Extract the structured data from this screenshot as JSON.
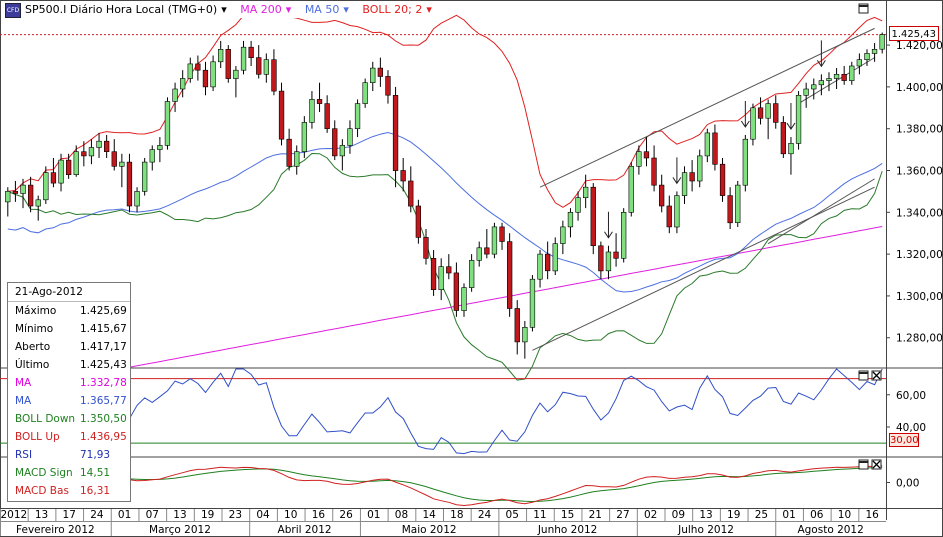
{
  "header": {
    "symbol": "SP500.I Diário Hora Local (TMG+0)",
    "ma200": "MA 200",
    "ma50": "MA 50",
    "boll": "BOLL 20; 2",
    "logo_text": "CFD"
  },
  "legend": {
    "date": "21-Ago-2012",
    "rows": [
      {
        "label": "Máximo",
        "value": "1.425,69",
        "color": "#000000"
      },
      {
        "label": "Mínimo",
        "value": "1.415,67",
        "color": "#000000"
      },
      {
        "label": "Aberto",
        "value": "1.417,17",
        "color": "#000000"
      },
      {
        "label": "Último",
        "value": "1.425,43",
        "color": "#000000"
      },
      {
        "label": "MA",
        "value": "1.332,78",
        "color": "#e000e0"
      },
      {
        "label": "MA",
        "value": "1.365,77",
        "color": "#3050d0"
      },
      {
        "label": "BOLL Down",
        "value": "1.350,50",
        "color": "#208020"
      },
      {
        "label": "BOLL Up",
        "value": "1.436,95",
        "color": "#d02020"
      },
      {
        "label": "RSI",
        "value": "71,93",
        "color": "#2030b0"
      },
      {
        "label": "MACD Sign",
        "value": "14,51",
        "color": "#208020"
      },
      {
        "label": "MACD Bas",
        "value": "16,31",
        "color": "#d02020"
      }
    ]
  },
  "price_labels": {
    "last": "1.425,43",
    "rsi_level": "30,00"
  },
  "chart_data": {
    "type": "candlestick",
    "y_axis_ticks": [
      "1.420,00",
      "1.400,00",
      "1.380,00",
      "1.360,00",
      "1.340,00",
      "1.320,00",
      "1.300,00",
      "1.280,00"
    ],
    "ylim": [
      1266,
      1432
    ],
    "rsi_ticks": [
      "60,00",
      "40,00"
    ],
    "rsi_ylim": [
      22,
      76
    ],
    "rsi_level": 30,
    "macd_ticks": [
      "0,00"
    ],
    "macd_ylim": [
      -24,
      24
    ],
    "x_day_labels": [
      "2012",
      "13",
      "17",
      "24",
      "01",
      "07",
      "13",
      "19",
      "23",
      "04",
      "10",
      "16",
      "26",
      "01",
      "08",
      "14",
      "18",
      "24",
      "05",
      "11",
      "15",
      "21",
      "27",
      "02",
      "09",
      "13",
      "19",
      "25",
      "01",
      "06",
      "10",
      "16"
    ],
    "x_month_labels": [
      "Fevereiro 2012",
      "Março 2012",
      "Abril 2012",
      "Maio 2012",
      "Junho 2012",
      "Julho 2012",
      "Agosto 2012"
    ],
    "colors": {
      "up": "#80e080",
      "down": "#c0181c",
      "ma200": "#e020e0",
      "ma50": "#4d6fe0",
      "boll_up": "#e02020",
      "boll_mid": "#e02020",
      "boll_down": "#2a7a2a",
      "rsi": "#3050c8",
      "macd_sign": "#208020",
      "macd_bas": "#d02020"
    },
    "ohlc": [
      [
        1345,
        1352,
        1338,
        1350
      ],
      [
        1350,
        1355,
        1345,
        1349
      ],
      [
        1349,
        1356,
        1342,
        1353
      ],
      [
        1353,
        1357,
        1340,
        1343
      ],
      [
        1343,
        1348,
        1336,
        1346
      ],
      [
        1346,
        1362,
        1344,
        1359
      ],
      [
        1359,
        1366,
        1352,
        1354
      ],
      [
        1354,
        1368,
        1350,
        1365
      ],
      [
        1365,
        1368,
        1356,
        1358
      ],
      [
        1358,
        1372,
        1357,
        1369
      ],
      [
        1369,
        1374,
        1362,
        1367
      ],
      [
        1367,
        1375,
        1363,
        1371
      ],
      [
        1371,
        1378,
        1366,
        1374
      ],
      [
        1374,
        1377,
        1366,
        1369
      ],
      [
        1369,
        1375,
        1360,
        1362
      ],
      [
        1362,
        1368,
        1352,
        1364
      ],
      [
        1364,
        1368,
        1340,
        1343
      ],
      [
        1343,
        1352,
        1340,
        1350
      ],
      [
        1350,
        1366,
        1348,
        1364
      ],
      [
        1364,
        1372,
        1360,
        1370
      ],
      [
        1370,
        1376,
        1364,
        1372
      ],
      [
        1372,
        1395,
        1370,
        1393
      ],
      [
        1393,
        1402,
        1388,
        1399
      ],
      [
        1399,
        1408,
        1395,
        1404
      ],
      [
        1404,
        1414,
        1402,
        1411
      ],
      [
        1411,
        1415,
        1403,
        1408
      ],
      [
        1408,
        1412,
        1396,
        1400
      ],
      [
        1400,
        1415,
        1398,
        1412
      ],
      [
        1412,
        1422,
        1409,
        1418
      ],
      [
        1418,
        1420,
        1402,
        1404
      ],
      [
        1404,
        1410,
        1395,
        1408
      ],
      [
        1408,
        1422,
        1406,
        1419
      ],
      [
        1419,
        1422,
        1410,
        1414
      ],
      [
        1414,
        1420,
        1404,
        1406
      ],
      [
        1406,
        1416,
        1402,
        1413
      ],
      [
        1413,
        1418,
        1396,
        1398
      ],
      [
        1398,
        1402,
        1372,
        1375
      ],
      [
        1375,
        1380,
        1360,
        1362
      ],
      [
        1362,
        1372,
        1358,
        1369
      ],
      [
        1369,
        1386,
        1366,
        1383
      ],
      [
        1383,
        1398,
        1380,
        1394
      ],
      [
        1394,
        1402,
        1388,
        1392
      ],
      [
        1392,
        1396,
        1378,
        1380
      ],
      [
        1380,
        1384,
        1365,
        1367
      ],
      [
        1367,
        1375,
        1360,
        1372
      ],
      [
        1372,
        1384,
        1368,
        1380
      ],
      [
        1380,
        1394,
        1376,
        1392
      ],
      [
        1392,
        1404,
        1390,
        1402
      ],
      [
        1402,
        1412,
        1398,
        1409
      ],
      [
        1409,
        1414,
        1400,
        1405
      ],
      [
        1405,
        1408,
        1392,
        1396
      ],
      [
        1396,
        1400,
        1352,
        1360
      ],
      [
        1360,
        1366,
        1350,
        1355
      ],
      [
        1355,
        1362,
        1340,
        1343
      ],
      [
        1343,
        1346,
        1325,
        1328
      ],
      [
        1328,
        1332,
        1315,
        1318
      ],
      [
        1318,
        1322,
        1300,
        1303
      ],
      [
        1303,
        1318,
        1298,
        1314
      ],
      [
        1314,
        1320,
        1308,
        1311
      ],
      [
        1311,
        1316,
        1290,
        1293
      ],
      [
        1293,
        1306,
        1290,
        1304
      ],
      [
        1304,
        1320,
        1302,
        1317
      ],
      [
        1317,
        1326,
        1314,
        1323
      ],
      [
        1323,
        1332,
        1318,
        1320
      ],
      [
        1320,
        1335,
        1318,
        1333
      ],
      [
        1333,
        1335,
        1322,
        1326
      ],
      [
        1326,
        1330,
        1290,
        1294
      ],
      [
        1294,
        1298,
        1272,
        1278
      ],
      [
        1278,
        1288,
        1270,
        1285
      ],
      [
        1285,
        1310,
        1283,
        1308
      ],
      [
        1308,
        1322,
        1304,
        1320
      ],
      [
        1320,
        1326,
        1308,
        1312
      ],
      [
        1312,
        1328,
        1310,
        1325
      ],
      [
        1325,
        1336,
        1320,
        1333
      ],
      [
        1333,
        1342,
        1328,
        1340
      ],
      [
        1340,
        1350,
        1336,
        1347
      ],
      [
        1347,
        1358,
        1342,
        1352
      ],
      [
        1352,
        1354,
        1320,
        1324
      ],
      [
        1324,
        1326,
        1308,
        1312
      ],
      [
        1312,
        1324,
        1308,
        1321
      ],
      [
        1321,
        1330,
        1314,
        1318
      ],
      [
        1318,
        1342,
        1316,
        1340
      ],
      [
        1340,
        1364,
        1338,
        1362
      ],
      [
        1362,
        1372,
        1358,
        1369
      ],
      [
        1369,
        1376,
        1362,
        1366
      ],
      [
        1366,
        1372,
        1350,
        1353
      ],
      [
        1353,
        1358,
        1340,
        1343
      ],
      [
        1343,
        1348,
        1330,
        1333
      ],
      [
        1333,
        1350,
        1330,
        1348
      ],
      [
        1348,
        1362,
        1344,
        1359
      ],
      [
        1359,
        1365,
        1350,
        1355
      ],
      [
        1355,
        1370,
        1352,
        1367
      ],
      [
        1367,
        1380,
        1364,
        1378
      ],
      [
        1378,
        1382,
        1360,
        1363
      ],
      [
        1363,
        1366,
        1345,
        1348
      ],
      [
        1348,
        1352,
        1332,
        1335
      ],
      [
        1335,
        1355,
        1333,
        1353
      ],
      [
        1353,
        1377,
        1350,
        1375
      ],
      [
        1375,
        1392,
        1372,
        1390
      ],
      [
        1390,
        1395,
        1382,
        1385
      ],
      [
        1385,
        1394,
        1375,
        1392
      ],
      [
        1392,
        1396,
        1380,
        1383
      ],
      [
        1383,
        1386,
        1366,
        1368
      ],
      [
        1368,
        1376,
        1358,
        1373
      ],
      [
        1373,
        1398,
        1370,
        1396
      ],
      [
        1396,
        1402,
        1390,
        1399
      ],
      [
        1399,
        1404,
        1394,
        1401
      ],
      [
        1401,
        1406,
        1396,
        1403
      ],
      [
        1403,
        1407,
        1398,
        1404
      ],
      [
        1404,
        1409,
        1399,
        1406
      ],
      [
        1406,
        1410,
        1401,
        1403
      ],
      [
        1403,
        1412,
        1401,
        1410
      ],
      [
        1410,
        1416,
        1406,
        1413
      ],
      [
        1413,
        1418,
        1410,
        1416
      ],
      [
        1416,
        1421,
        1412,
        1418
      ],
      [
        1418,
        1426,
        1416,
        1425
      ]
    ]
  }
}
